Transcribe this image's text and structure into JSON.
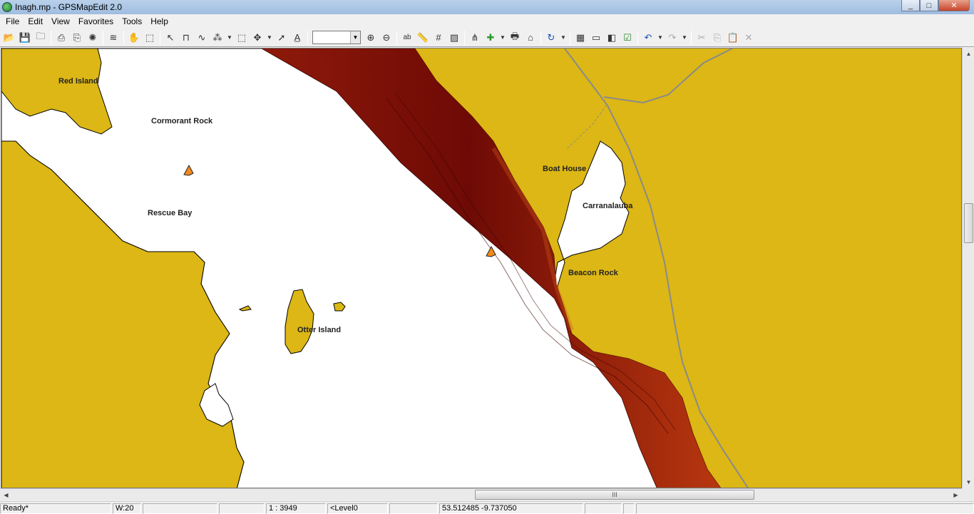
{
  "window": {
    "title": "Inagh.mp - GPSMapEdit 2.0",
    "min": "_",
    "max": "□",
    "close": "✕"
  },
  "menu": [
    "File",
    "Edit",
    "View",
    "Favorites",
    "Tools",
    "Help"
  ],
  "toolbar": {
    "scale_value": "",
    "icons": [
      "open-icon",
      "save-icon",
      "folder-icon",
      "properties-icon",
      "attach-icon",
      "gps-icon",
      "track-icon",
      "hand-icon",
      "zoom-rect-icon",
      "select-icon",
      "create-icon",
      "edit-polyline-icon",
      "node-icon",
      "rect-select-icon",
      "move-icon",
      "add-point-icon",
      "label-icon",
      "zoom-in-icon",
      "zoom-out-icon",
      "text-label-icon",
      "ruler-icon",
      "grid-icon",
      "hatch-icon",
      "routing-icon",
      "node-link-icon",
      "print-icon",
      "house-icon",
      "transform-icon",
      "raster-icon",
      "bounds-icon",
      "filter-icon",
      "check-icon",
      "undo-icon",
      "redo-icon",
      "cut-icon",
      "copy-icon",
      "paste-icon",
      "delete-icon"
    ]
  },
  "colors": {
    "land": "#dcb715",
    "water": "#ffffff",
    "depth_dark": "#6e0a05",
    "depth_mid": "#8f1a0b",
    "depth_light": "#c84818",
    "road": "#8a8a8a"
  },
  "map": {
    "labels": [
      {
        "id": "red-island",
        "text": "Red Island"
      },
      {
        "id": "cormorant-rock",
        "text": "Cormorant Rock"
      },
      {
        "id": "rescue-bay",
        "text": "Rescue Bay"
      },
      {
        "id": "otter-island",
        "text": "Otter Island"
      },
      {
        "id": "boat-house",
        "text": "Boat House"
      },
      {
        "id": "carranalauba",
        "text": "Carranalauba"
      },
      {
        "id": "beacon-rock",
        "text": "Beacon Rock"
      }
    ]
  },
  "status": {
    "state": "Ready*",
    "width": "W:20",
    "scale": "1 : 3949",
    "level": "<Level0",
    "coords": "53.512485 -9.737050"
  },
  "scroll": {
    "hthumb": "III",
    "vthumb": "≡"
  }
}
